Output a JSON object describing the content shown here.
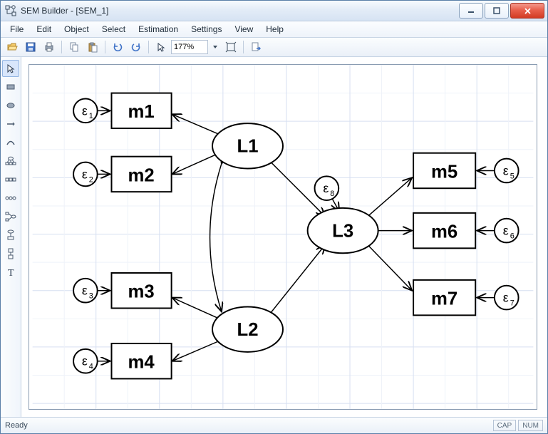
{
  "window": {
    "title": "SEM Builder - [SEM_1]"
  },
  "menus": {
    "file": "File",
    "edit": "Edit",
    "object": "Object",
    "select": "Select",
    "estimation": "Estimation",
    "settings": "Settings",
    "view": "View",
    "help": "Help"
  },
  "toolbar": {
    "zoom": "177%"
  },
  "status": {
    "ready": "Ready",
    "cap": "CAP",
    "num": "NUM"
  },
  "diagram": {
    "latent": {
      "L1": "L1",
      "L2": "L2",
      "L3": "L3"
    },
    "observed": {
      "m1": "m1",
      "m2": "m2",
      "m3": "m3",
      "m4": "m4",
      "m5": "m5",
      "m6": "m6",
      "m7": "m7"
    },
    "errors": {
      "e1": "ε",
      "e1s": "1",
      "e2": "ε",
      "e2s": "2",
      "e3": "ε",
      "e3s": "3",
      "e4": "ε",
      "e4s": "4",
      "e5": "ε",
      "e5s": "5",
      "e6": "ε",
      "e6s": "6",
      "e7": "ε",
      "e7s": "7",
      "e8": "ε",
      "e8s": "8"
    }
  }
}
